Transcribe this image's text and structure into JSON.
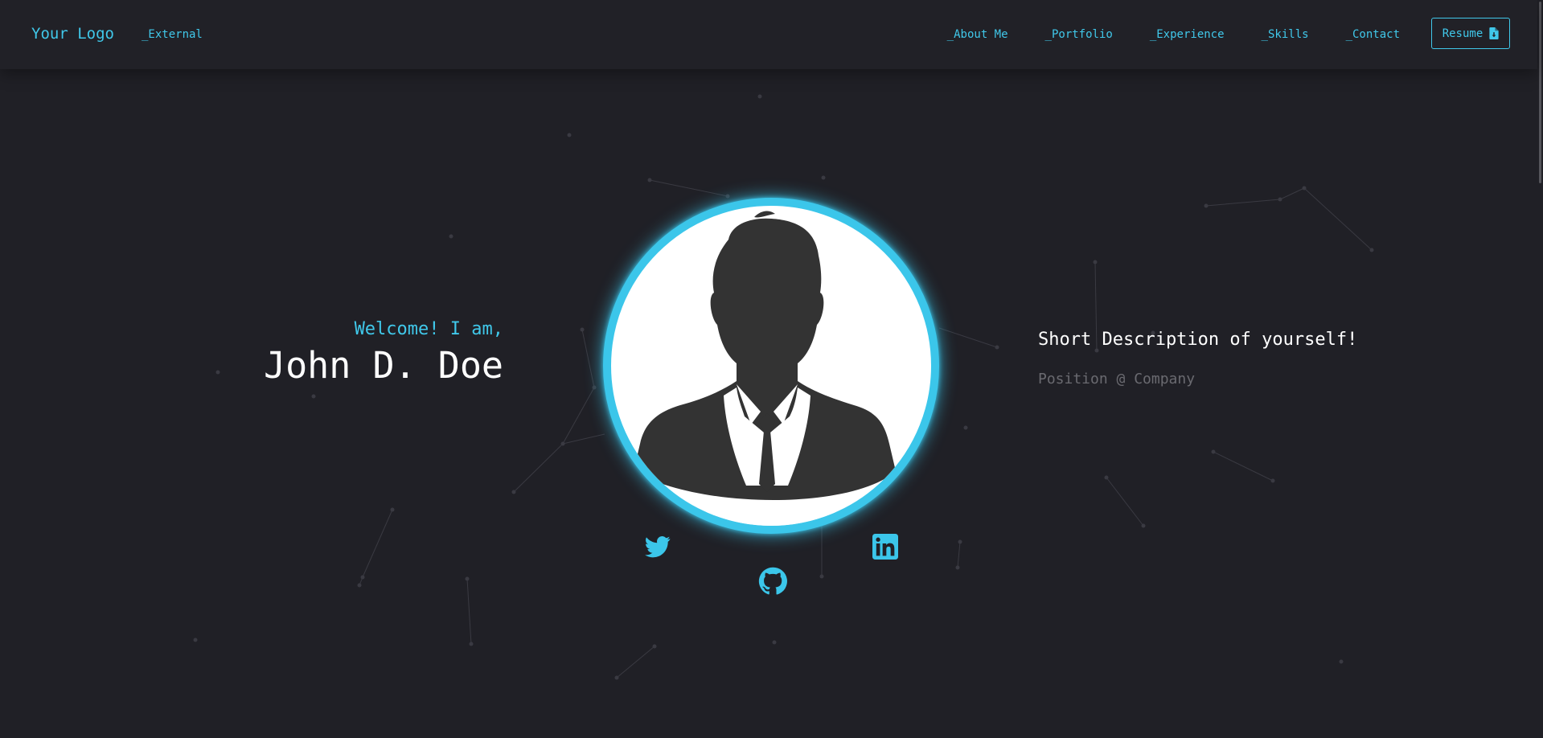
{
  "nav": {
    "logo": "Your Logo",
    "external": "_External",
    "links": [
      "_About Me",
      "_Portfolio",
      "_Experience",
      "_Skills",
      "_Contact"
    ],
    "resume_label": "Resume",
    "resume_icon": "file-download-icon"
  },
  "hero": {
    "welcome": "Welcome! I am,",
    "name": "John D. Doe",
    "avatar_icon": "person-silhouette-icon",
    "description": "Short Description of yourself!",
    "position": "Position @ Company"
  },
  "social": [
    {
      "name": "twitter",
      "icon": "twitter-icon"
    },
    {
      "name": "github",
      "icon": "github-icon"
    },
    {
      "name": "linkedin",
      "icon": "linkedin-icon"
    }
  ],
  "colors": {
    "background": "#202026",
    "navbar": "#212127",
    "accent": "#40c8ea",
    "text": "#ffffff",
    "muted": "#6a6a70"
  }
}
